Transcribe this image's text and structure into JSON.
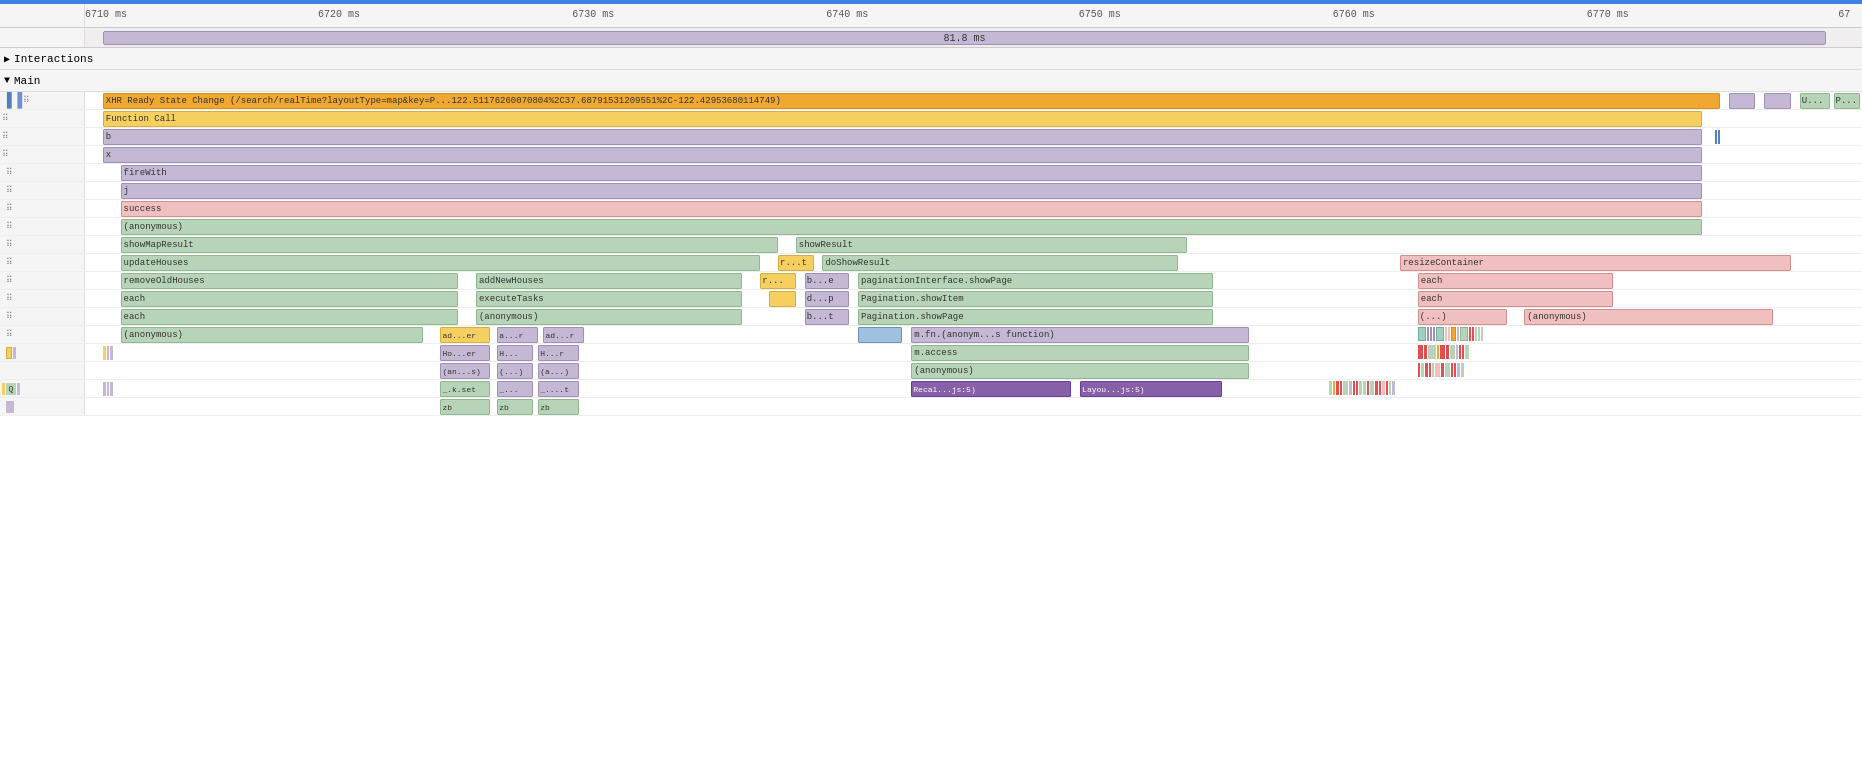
{
  "header": {
    "ticks": [
      {
        "label": "6710 ms",
        "pct": 0
      },
      {
        "label": "6720 ms",
        "pct": 14.3
      },
      {
        "label": "6730 ms",
        "pct": 28.6
      },
      {
        "label": "6740 ms",
        "pct": 42.9
      },
      {
        "label": "6750 ms",
        "pct": 57.1
      },
      {
        "label": "6760 ms",
        "pct": 71.4
      },
      {
        "label": "6770 ms",
        "pct": 85.7
      },
      {
        "label": "67",
        "pct": 100
      }
    ]
  },
  "interaction_bar": {
    "label": "81.8 ms",
    "left_pct": 1,
    "width_pct": 97
  },
  "interactions_section": {
    "label": "Interactions",
    "arrow": "▶"
  },
  "main_section": {
    "label": "Main",
    "arrow": "▼"
  },
  "rows": [
    {
      "id": "xhr",
      "label": "XHR Ready State Change (/search/realTime?layoutType=map&key=P...122.51176260070804%2C37.68791531209551%2C-122.42953680114749)",
      "color": "orange",
      "left_pct": 1,
      "width_pct": 91,
      "extra_blocks": [
        {
          "color": "purple",
          "left_pct": 92.5,
          "width_pct": 1.5,
          "label": ""
        },
        {
          "color": "purple",
          "left_pct": 94.5,
          "width_pct": 1.5,
          "label": ""
        },
        {
          "color": "green",
          "left_pct": 96.5,
          "width_pct": 3,
          "label": "U..."
        },
        {
          "color": "green",
          "left_pct": 99.8,
          "width_pct": 0.2,
          "label": "P..."
        }
      ]
    },
    {
      "id": "function-call",
      "label": "Function Call",
      "color": "yellow",
      "left_pct": 1,
      "width_pct": 90
    },
    {
      "id": "b",
      "label": "b",
      "color": "purple",
      "left_pct": 1,
      "width_pct": 90
    },
    {
      "id": "x",
      "label": "x",
      "color": "purple",
      "left_pct": 1,
      "width_pct": 90
    },
    {
      "id": "firewith",
      "label": "fireWith",
      "color": "purple",
      "left_pct": 2,
      "width_pct": 89
    },
    {
      "id": "j",
      "label": "j",
      "color": "purple",
      "left_pct": 2,
      "width_pct": 89
    },
    {
      "id": "success",
      "label": "success",
      "color": "pink",
      "left_pct": 2,
      "width_pct": 89
    },
    {
      "id": "anonymous",
      "label": "(anonymous)",
      "color": "green",
      "left_pct": 2,
      "width_pct": 89
    },
    {
      "id": "showmapresult",
      "label": "showMapResult",
      "color": "green",
      "left_pct": 2,
      "width_pct": 39,
      "extra_blocks": [
        {
          "color": "green",
          "left_pct": 42,
          "width_pct": 22,
          "label": "showResult"
        }
      ]
    },
    {
      "id": "updatehouses",
      "label": "updateHouses",
      "color": "green",
      "left_pct": 2,
      "width_pct": 37,
      "extra_blocks": [
        {
          "color": "yellow",
          "left_pct": 40,
          "width_pct": 1.5,
          "label": "r...t"
        },
        {
          "color": "green",
          "left_pct": 42,
          "width_pct": 20,
          "label": "doShowResult"
        },
        {
          "color": "pink",
          "left_pct": 76,
          "width_pct": 22,
          "label": "resizeContainer"
        }
      ]
    },
    {
      "id": "removeoldhouses",
      "label": "removeOldHouses",
      "color": "green",
      "left_pct": 2,
      "width_pct": 21,
      "extra_blocks": [
        {
          "color": "green",
          "left_pct": 24,
          "width_pct": 16,
          "label": "addNewHouses"
        },
        {
          "color": "yellow",
          "left_pct": 40,
          "width_pct": 1.5,
          "label": "r..."
        },
        {
          "color": "purple",
          "left_pct": 42.5,
          "width_pct": 2,
          "label": "b...e"
        },
        {
          "color": "green",
          "left_pct": 45,
          "width_pct": 20,
          "label": "paginationInterface.showPage"
        },
        {
          "color": "pink",
          "left_pct": 76,
          "width_pct": 12,
          "label": "each"
        }
      ]
    },
    {
      "id": "each1",
      "label": "each",
      "color": "green",
      "left_pct": 2,
      "width_pct": 21,
      "extra_blocks": [
        {
          "color": "green",
          "left_pct": 24,
          "width_pct": 16,
          "label": "executeTasks"
        },
        {
          "color": "yellow",
          "left_pct": 40.5,
          "width_pct": 1,
          "label": ""
        },
        {
          "color": "purple",
          "left_pct": 42.5,
          "width_pct": 2,
          "label": "d...p"
        },
        {
          "color": "green",
          "left_pct": 45,
          "width_pct": 20,
          "label": "Pagination.showItem"
        },
        {
          "color": "pink",
          "left_pct": 76,
          "width_pct": 12,
          "label": "each"
        }
      ]
    },
    {
      "id": "each2",
      "label": "each",
      "color": "green",
      "left_pct": 2,
      "width_pct": 21,
      "extra_blocks": [
        {
          "color": "green",
          "left_pct": 24,
          "width_pct": 16,
          "label": "(anonymous)"
        },
        {
          "color": "purple",
          "left_pct": 42.5,
          "width_pct": 2,
          "label": "b...t"
        },
        {
          "color": "green",
          "left_pct": 45,
          "width_pct": 20,
          "label": "Pagination.showPage"
        },
        {
          "color": "pink",
          "left_pct": 76,
          "width_pct": 6,
          "label": "(...)"
        },
        {
          "color": "pink",
          "left_pct": 83,
          "width_pct": 14,
          "label": "(anonymous)"
        }
      ]
    },
    {
      "id": "anon2",
      "label": "(anonymous)",
      "color": "green",
      "left_pct": 2,
      "width_pct": 18,
      "extra_blocks": [
        {
          "color": "yellow",
          "left_pct": 21,
          "width_pct": 2,
          "label": "ad...er"
        },
        {
          "color": "purple",
          "left_pct": 23.5,
          "width_pct": 2.5,
          "label": "a...r"
        },
        {
          "color": "purple",
          "left_pct": 26.5,
          "width_pct": 2.5,
          "label": "ad...r"
        },
        {
          "color": "blue",
          "left_pct": 44,
          "width_pct": 3,
          "label": ""
        },
        {
          "color": "purple",
          "left_pct": 47.5,
          "width_pct": 18,
          "label": "m.fn.(anonym...s function)"
        }
      ]
    },
    {
      "id": "dense1",
      "label": "",
      "color": "none",
      "left_pct": 0,
      "width_pct": 0,
      "extra_blocks": [
        {
          "color": "purple",
          "left_pct": 21,
          "width_pct": 2.5,
          "label": "Ho...er"
        },
        {
          "color": "purple",
          "left_pct": 23.5,
          "width_pct": 2,
          "label": "H..."
        },
        {
          "color": "purple",
          "left_pct": 26.5,
          "width_pct": 2,
          "label": "H...r"
        },
        {
          "color": "green",
          "left_pct": 47.5,
          "width_pct": 18,
          "label": "m.access"
        }
      ]
    },
    {
      "id": "dense2",
      "label": "",
      "color": "none",
      "left_pct": 0,
      "width_pct": 0,
      "extra_blocks": [
        {
          "color": "purple",
          "left_pct": 21,
          "width_pct": 2.5,
          "label": "(an...s)"
        },
        {
          "color": "purple",
          "left_pct": 23.5,
          "width_pct": 2,
          "label": "(...)"
        },
        {
          "color": "purple",
          "left_pct": 26.5,
          "width_pct": 2,
          "label": "(a...)"
        },
        {
          "color": "green",
          "left_pct": 47.5,
          "width_pct": 18,
          "label": "(anonymous)"
        }
      ]
    },
    {
      "id": "Q-row",
      "label": "Q",
      "color": "none",
      "left_pct": 0,
      "width_pct": 0,
      "q_block": true,
      "extra_blocks": [
        {
          "color": "green",
          "left_pct": 21,
          "width_pct": 2.5,
          "label": "_.k.set"
        },
        {
          "color": "purple",
          "left_pct": 23.5,
          "width_pct": 2,
          "label": "_..."
        },
        {
          "color": "purple",
          "left_pct": 26.5,
          "width_pct": 2,
          "label": "_....t"
        },
        {
          "color": "dark-purple",
          "left_pct": 47.5,
          "width_pct": 9,
          "label": "Recal...js:5)"
        },
        {
          "color": "dark-purple",
          "left_pct": 57,
          "width_pct": 8,
          "label": "Layou...js:5)"
        }
      ]
    },
    {
      "id": "zb-row",
      "label": "",
      "color": "none",
      "left_pct": 0,
      "width_pct": 0,
      "extra_blocks": [
        {
          "color": "green",
          "left_pct": 21,
          "width_pct": 2.5,
          "label": "zb"
        },
        {
          "color": "green",
          "left_pct": 23.5,
          "width_pct": 2,
          "label": "zb"
        },
        {
          "color": "green",
          "left_pct": 26.5,
          "width_pct": 2,
          "label": "zb"
        }
      ]
    }
  ],
  "colors": {
    "accent_blue": "#4080e0",
    "timeline_bg": "#f5f5f5",
    "border": "#dddddd"
  }
}
